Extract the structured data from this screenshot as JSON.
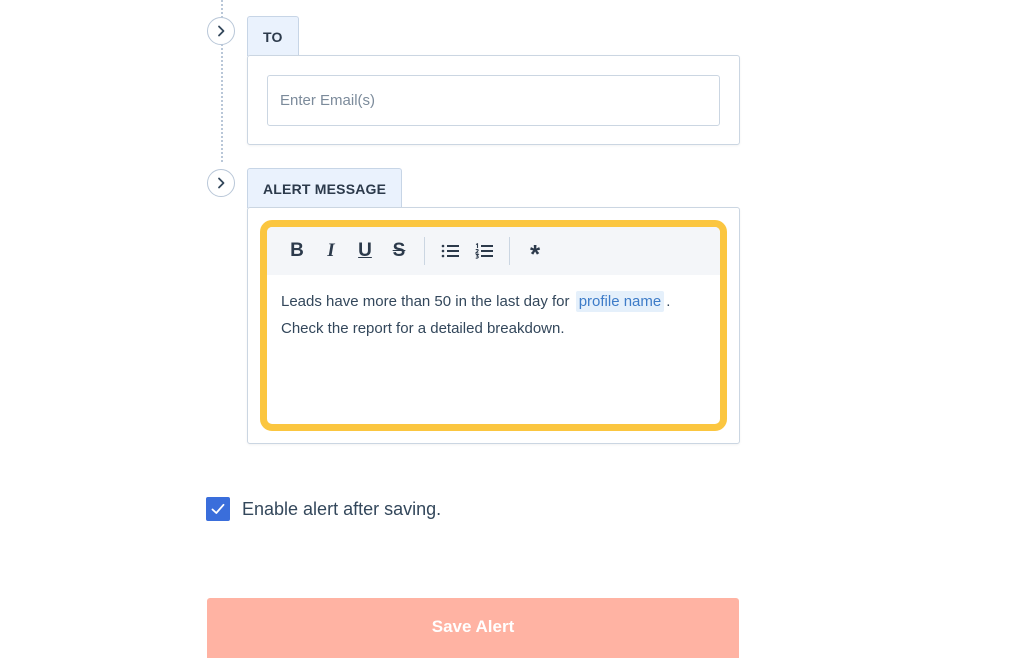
{
  "to_section": {
    "tab_label": "TO",
    "email_input": {
      "value": "",
      "placeholder": "Enter Email(s)"
    }
  },
  "message_section": {
    "tab_label": "ALERT MESSAGE",
    "toolbar": {
      "bold_label": "B",
      "italic_label": "I",
      "underline_label": "U",
      "strike_label": "S",
      "bulleted_list_icon": "bulleted-list-icon",
      "numbered_list_icon": "numbered-list-icon",
      "personalize_label": "*"
    },
    "body": {
      "line1_prefix": "Leads have more than 50 in the last day for",
      "token": "profile name",
      "line1_suffix": ".",
      "line2": "Check the report for a detailed breakdown."
    }
  },
  "enable_alert": {
    "checked": true,
    "label": "Enable alert after saving."
  },
  "save_button": {
    "label": "Save Alert"
  },
  "colors": {
    "highlight": "#fbc640",
    "checkbox": "#3a6edb",
    "save_button": "#ffb3a3",
    "token_text": "#3e7cc8",
    "tab_background": "#eaf2fd"
  }
}
